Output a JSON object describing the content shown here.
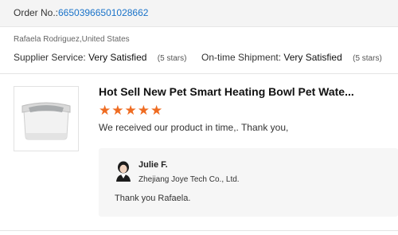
{
  "order": {
    "label": "Order No.:",
    "number": "66503966501028662"
  },
  "buyer": {
    "name_location": "Rafaela Rodriguez,United States"
  },
  "ratings": {
    "supplier_service": {
      "label": "Supplier Service:",
      "value": "Very Satisfied",
      "stars": "(5 stars)"
    },
    "ontime_shipment": {
      "label": "On-time Shipment:",
      "value": "Very Satisfied",
      "stars": "(5 stars)"
    }
  },
  "review": {
    "product_title": "Hot Sell New Pet Smart Heating Bowl Pet Wate...",
    "star_count": 5,
    "stars_display": "★★★★★",
    "star_color": "#ef6c22",
    "text": "We received our product in time,.  Thank you,"
  },
  "reply": {
    "seller_name": "Julie F.",
    "company": "Zhejiang Joye Tech Co., Ltd.",
    "text": "Thank you Rafaela."
  },
  "colors": {
    "link": "#1a73c9",
    "reply_bg": "#f6f6f6",
    "header_bg": "#f4f4f4"
  }
}
